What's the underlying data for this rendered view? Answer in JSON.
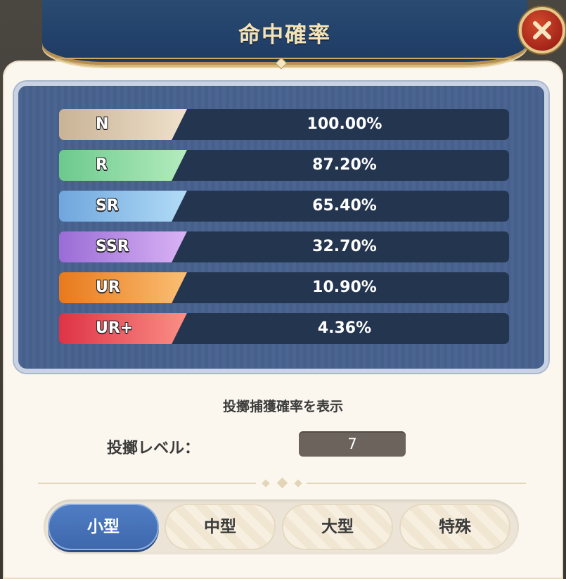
{
  "header": {
    "title": "命中確率"
  },
  "close": {
    "icon": "close-icon",
    "color": "#a5251a"
  },
  "rates": [
    {
      "rarity": "N",
      "value": "100.00%",
      "color_from": "#c9b396",
      "color_to": "#efe1cb"
    },
    {
      "rarity": "R",
      "value": "87.20%",
      "color_from": "#6cc98e",
      "color_to": "#b4ecbe"
    },
    {
      "rarity": "SR",
      "value": "65.40%",
      "color_from": "#6fa6dd",
      "color_to": "#b2dcf7"
    },
    {
      "rarity": "SSR",
      "value": "32.70%",
      "color_from": "#9a6cd6",
      "color_to": "#d9b3f5"
    },
    {
      "rarity": "UR",
      "value": "10.90%",
      "color_from": "#e8791c",
      "color_to": "#fbbf73"
    },
    {
      "rarity": "UR+",
      "value": "4.36%",
      "color_from": "#df3346",
      "color_to": "#fb8f86"
    }
  ],
  "throw_capture": {
    "subtitle": "投擲捕獲確率を表示",
    "level_label": "投擲レベル：",
    "level_value": "7"
  },
  "tabs": [
    {
      "label": "小型",
      "active": true
    },
    {
      "label": "中型",
      "active": false
    },
    {
      "label": "大型",
      "active": false
    },
    {
      "label": "特殊",
      "active": false
    }
  ]
}
